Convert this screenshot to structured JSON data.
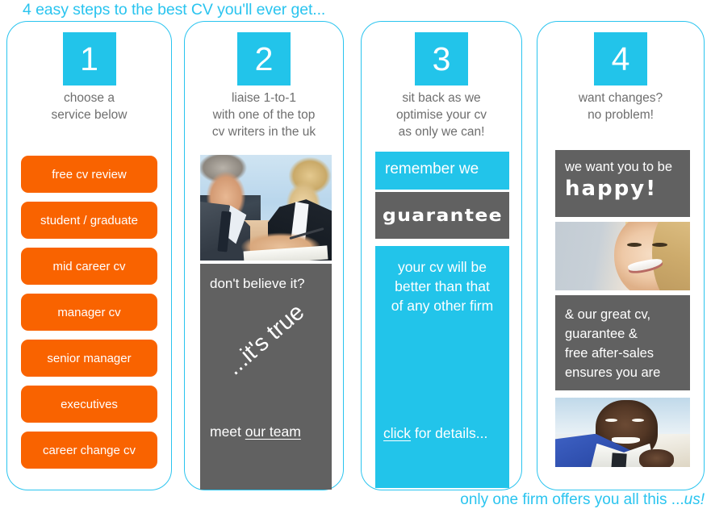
{
  "headline": "4 easy steps to the best CV you'll ever get...",
  "footer": {
    "text": "only one firm offers you all this ...",
    "emphasis": "us!"
  },
  "colors": {
    "cyan": "#22c4ea",
    "orange": "#f96300",
    "gray_panel": "#616161",
    "caption_text": "#6e6e6e",
    "white": "#ffffff"
  },
  "columns": [
    {
      "number": "1",
      "caption_lines": [
        "choose a",
        "service below"
      ],
      "services": [
        "free cv review",
        "student / graduate",
        "mid career cv",
        "manager cv",
        "senior manager",
        "executives",
        "career change cv"
      ]
    },
    {
      "number": "2",
      "caption_lines": [
        "liaise 1-to-1",
        "with one of the top",
        "cv writers in the uk"
      ],
      "photo": "two-business-people-consulting-photo",
      "panel": {
        "top_line": "don't believe it?",
        "rotated_line": "...it's true",
        "bottom_prefix": "meet ",
        "bottom_link": "our team"
      }
    },
    {
      "number": "3",
      "caption_lines": [
        "sit back as we",
        "optimise your cv",
        "as only we can!"
      ],
      "remember_line": "remember we",
      "guarantee_word": "guarantee",
      "promise_lines": [
        "your cv will be",
        "better than that",
        "of any other firm"
      ],
      "click_link": "click",
      "click_suffix": " for details..."
    },
    {
      "number": "4",
      "caption_lines": [
        "want changes?",
        "no problem!"
      ],
      "happy_line": "we want you to be",
      "happy_word": "happy!",
      "photo_laugh": "laughing-woman-photo",
      "ensures_lines": [
        "& our great cv,",
        "guarantee &",
        "free after-sales",
        "ensures you are"
      ],
      "photo_man": "smiling-man-photo"
    }
  ]
}
